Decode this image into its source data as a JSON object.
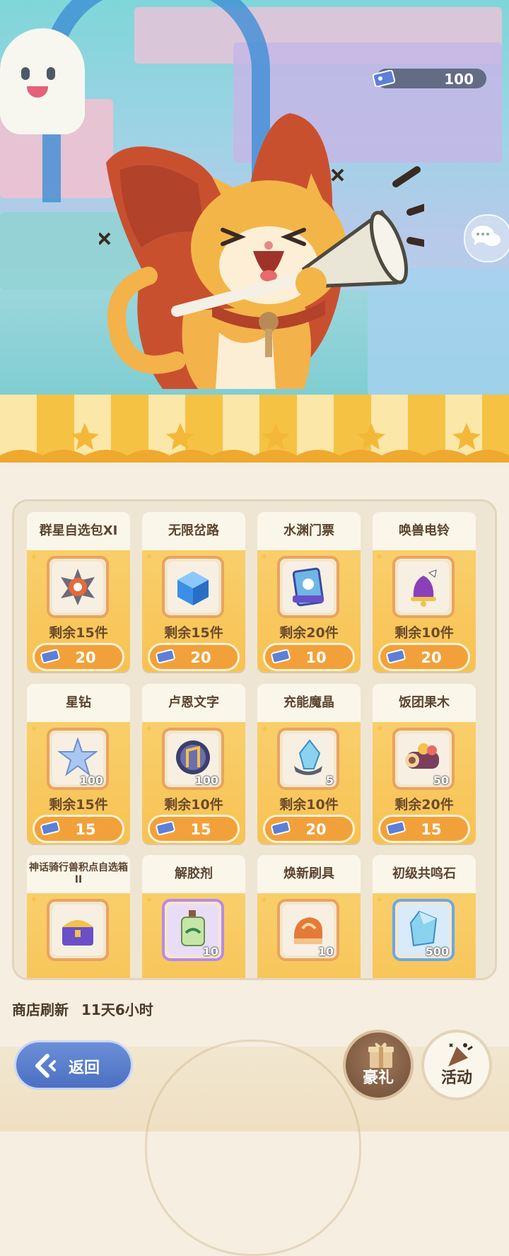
{
  "header": {
    "currency_amount": "100"
  },
  "shop_items": [
    {
      "name": "群星自选包XI",
      "remaining": "剩余15件",
      "price": "20",
      "qty": ""
    },
    {
      "name": "无限岔路",
      "remaining": "剩余15件",
      "price": "20",
      "qty": ""
    },
    {
      "name": "水渊门票",
      "remaining": "剩余20件",
      "price": "10",
      "qty": ""
    },
    {
      "name": "唤兽电铃",
      "remaining": "剩余10件",
      "price": "20",
      "qty": ""
    },
    {
      "name": "星钻",
      "remaining": "剩余15件",
      "price": "15",
      "qty": "100"
    },
    {
      "name": "卢恩文字",
      "remaining": "剩余10件",
      "price": "15",
      "qty": "100"
    },
    {
      "name": "充能魔晶",
      "remaining": "剩余10件",
      "price": "20",
      "qty": "5"
    },
    {
      "name": "饭团果木",
      "remaining": "剩余20件",
      "price": "15",
      "qty": "50"
    },
    {
      "name": "神话骑行兽积点自选箱II",
      "remaining": "",
      "price": "",
      "qty": ""
    },
    {
      "name": "解胶剂",
      "remaining": "",
      "price": "",
      "qty": "10"
    },
    {
      "name": "焕新刷具",
      "remaining": "",
      "price": "",
      "qty": "10"
    },
    {
      "name": "初级共鸣石",
      "remaining": "",
      "price": "",
      "qty": "500"
    }
  ],
  "footer": {
    "refresh_label": "商店刷新",
    "refresh_time": "11天6小时",
    "back_label": "返回",
    "gift_label": "豪礼",
    "event_label": "活动"
  },
  "icons": {
    "currency": "ticket-icon",
    "chat": "chat-bubbles-icon",
    "back": "chevron-left-icon",
    "gift": "gift-box-icon",
    "event": "party-popper-icon"
  },
  "colors": {
    "accent": "#f2a13a",
    "card_lower": "#f7c253",
    "back_button": "#4c6fc2",
    "gift_button": "#6e4c36"
  }
}
